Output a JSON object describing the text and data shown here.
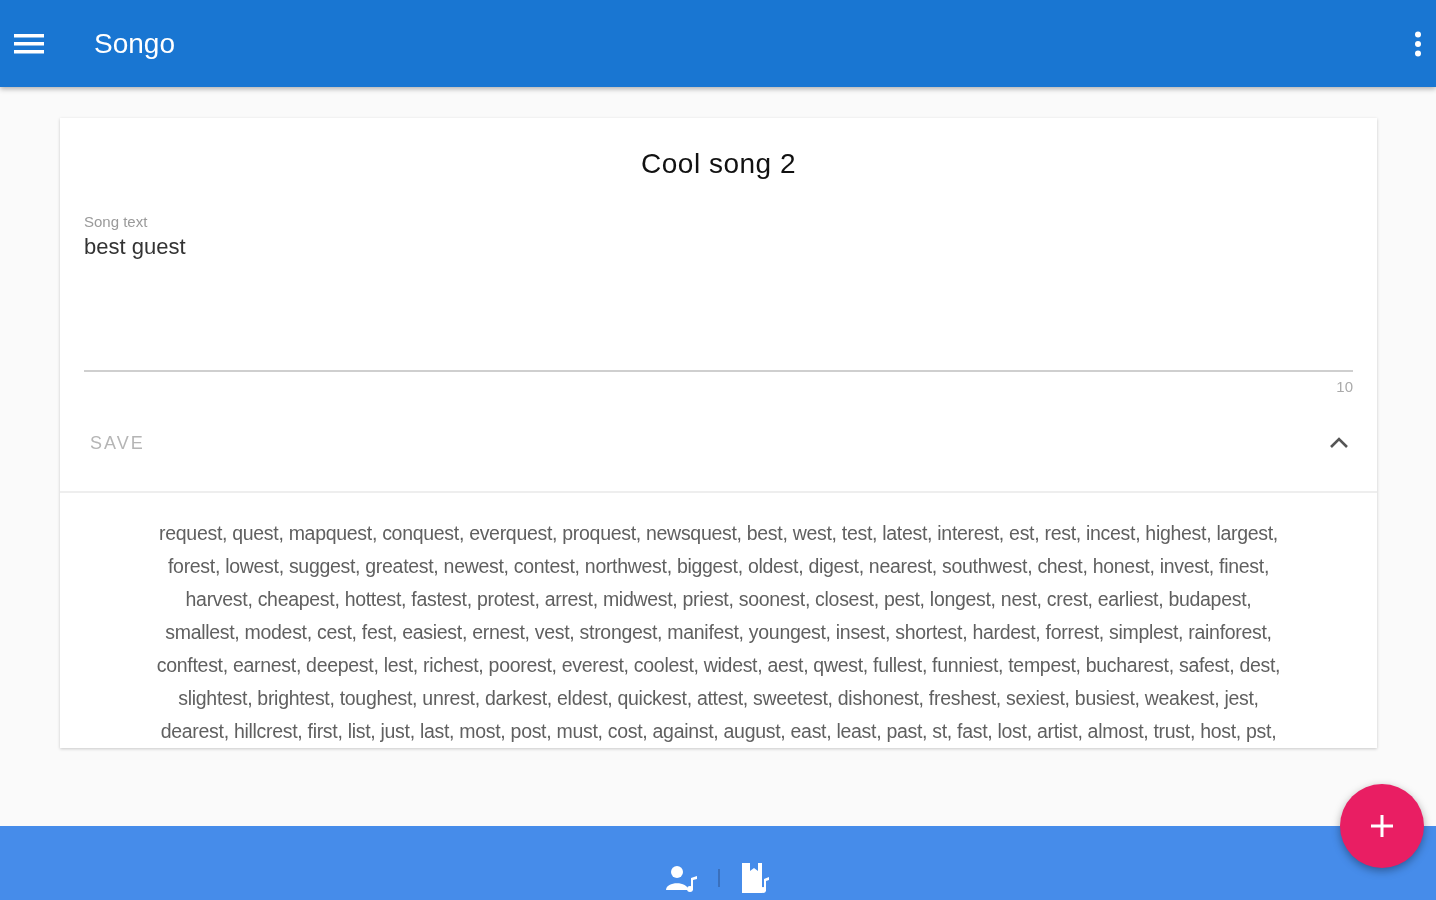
{
  "app_bar": {
    "title": "Songo"
  },
  "song": {
    "title": "Cool song 2",
    "text_field": {
      "label": "Song text",
      "value": "best guest",
      "counter": "10"
    },
    "save_button": {
      "label": "SAVE",
      "disabled": true
    },
    "rhymes_panel": {
      "expanded": true
    }
  },
  "rhymes": {
    "lines": [
      "request, quest, mapquest, conquest, everquest, proquest, newsquest, best, west, test, latest, interest, est, rest, incest, highest, largest,",
      "forest, lowest, suggest, greatest, newest, contest, northwest, biggest, oldest, digest, nearest, southwest, chest, honest, invest, finest,",
      "harvest, cheapest, hottest, fastest, protest, arrest, midwest, priest, soonest, closest, pest, longest, nest, crest, earliest, budapest,",
      "smallest, modest, cest, fest, easiest, ernest, vest, strongest, manifest, youngest, insest, shortest, hardest, forrest, simplest, rainforest,",
      "conftest, earnest, deepest, lest, richest, poorest, everest, coolest, widest, aest, qwest, fullest, funniest, tempest, bucharest, safest, dest,",
      "slightest, brightest, toughest, unrest, darkest, eldest, quickest, attest, sweetest, dishonest, freshest, sexiest, busiest, weakest, jest,",
      "dearest, hillcrest, first, list, just, last, most, post, must, cost, against, august, east, least, past, st, fast, lost, artist, almost, trust, host, pst,"
    ]
  }
}
